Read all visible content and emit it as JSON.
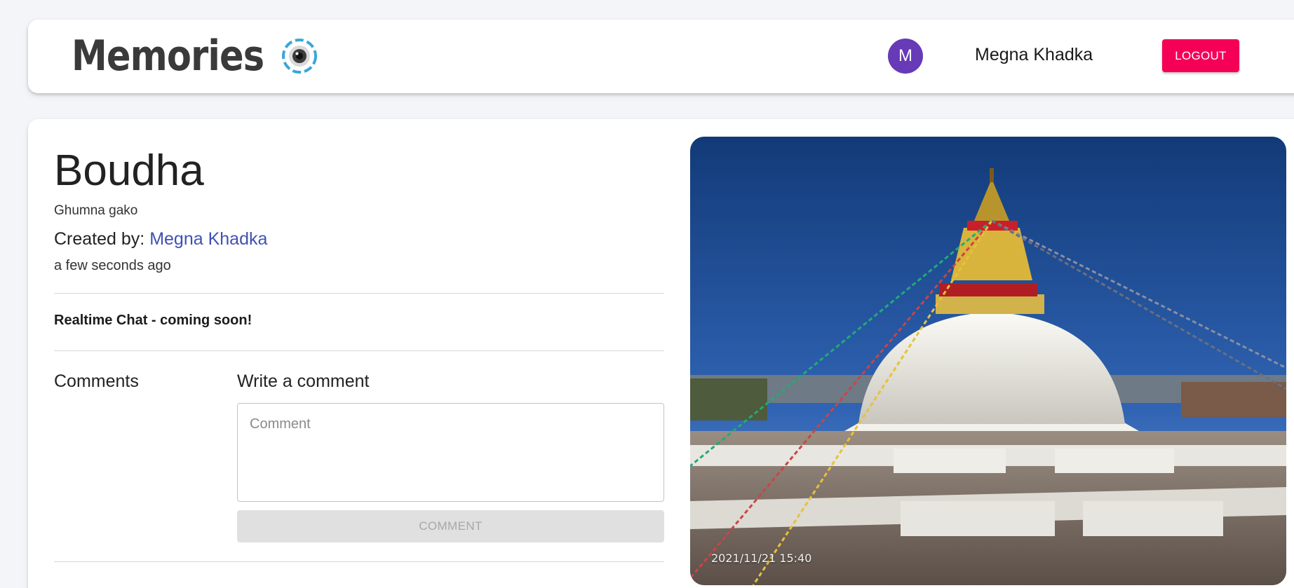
{
  "header": {
    "brand_text": "Memories",
    "brand_icon": "camera-lens-icon",
    "avatar_initial": "M",
    "avatar_color": "#673ab7",
    "user_name": "Megna Khadka",
    "logout_label": "LOGOUT",
    "logout_color": "#f50057"
  },
  "post": {
    "title": "Boudha",
    "tags": "Ghumna gako",
    "created_by_label": "Created by:",
    "author": "Megna Khadka",
    "time_ago": "a few seconds ago",
    "realtime_notice": "Realtime Chat - coming soon!",
    "comments_heading": "Comments",
    "write_heading": "Write a comment",
    "comment_placeholder": "Comment",
    "comment_button_label": "COMMENT",
    "photo_timestamp": "2021/11/21 15:40"
  }
}
